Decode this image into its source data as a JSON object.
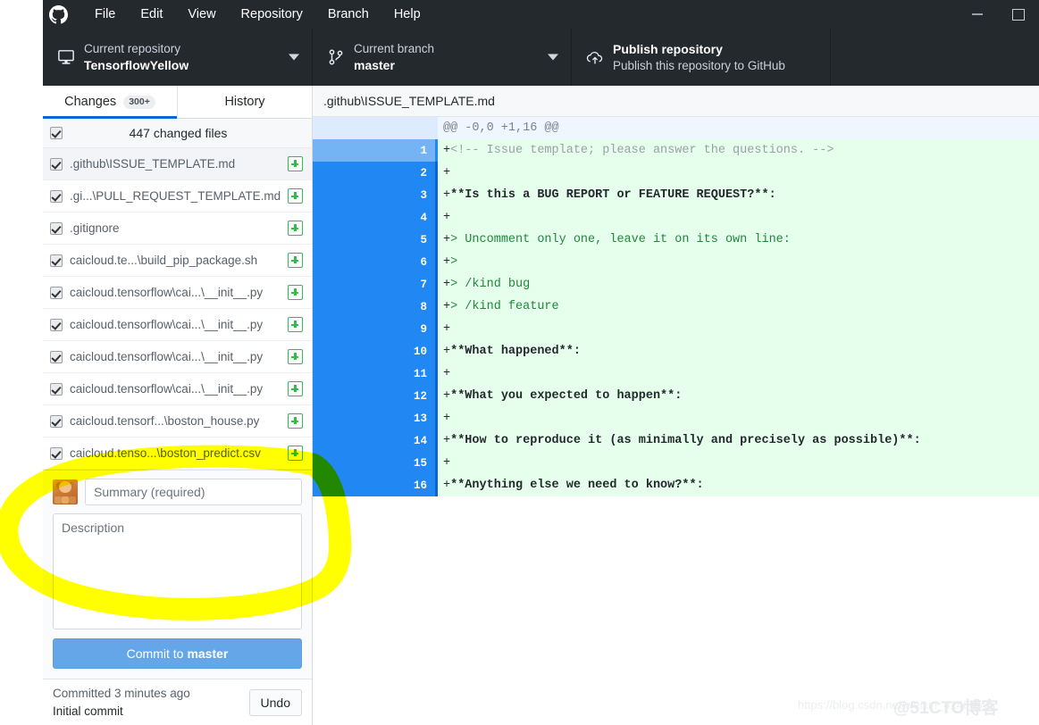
{
  "window": {
    "logo_icon": "github-logo-icon",
    "menu": [
      "File",
      "Edit",
      "View",
      "Repository",
      "Branch",
      "Help"
    ],
    "controls": {
      "minimize": "minimize-icon",
      "maximize": "maximize-icon"
    }
  },
  "toolbar": {
    "repository": {
      "icon": "repository-icon",
      "label": "Current repository",
      "value": "TensorflowYellow",
      "caret": "chevron-down-icon"
    },
    "branch": {
      "icon": "branch-icon",
      "label": "Current branch",
      "value": "master",
      "caret": "chevron-down-icon"
    },
    "publish": {
      "icon": "cloud-upload-icon",
      "title": "Publish repository",
      "subtitle": "Publish this repository to GitHub"
    }
  },
  "sidebar": {
    "tabs": [
      {
        "label": "Changes",
        "count": "300+",
        "active": true
      },
      {
        "label": "History",
        "count": "",
        "active": false
      }
    ],
    "select_all_label": "447 changed files",
    "files": [
      {
        "name": ".github\\ISSUE_TEMPLATE.md",
        "status": "added",
        "selected": true
      },
      {
        "name": ".gi...\\PULL_REQUEST_TEMPLATE.md",
        "status": "added",
        "selected": false
      },
      {
        "name": ".gitignore",
        "status": "added",
        "selected": false
      },
      {
        "name": "caicloud.te...\\build_pip_package.sh",
        "status": "added",
        "selected": false
      },
      {
        "name": "caicloud.tensorflow\\cai...\\__init__.py",
        "status": "added",
        "selected": false
      },
      {
        "name": "caicloud.tensorflow\\cai...\\__init__.py",
        "status": "added",
        "selected": false
      },
      {
        "name": "caicloud.tensorflow\\cai...\\__init__.py",
        "status": "added",
        "selected": false
      },
      {
        "name": "caicloud.tensorflow\\cai...\\__init__.py",
        "status": "added",
        "selected": false
      },
      {
        "name": "caicloud.tensorf...\\boston_house.py",
        "status": "added",
        "selected": false
      },
      {
        "name": "caicloud.tenso...\\boston_predict.csv",
        "status": "added",
        "selected": false
      }
    ],
    "commit": {
      "avatar": "user-avatar",
      "summary_placeholder": "Summary (required)",
      "description_placeholder": "Description",
      "button_prefix": "Commit to",
      "button_branch": "master"
    },
    "status": {
      "line1": "Committed 3 minutes ago",
      "line2": "Initial commit",
      "undo_label": "Undo"
    }
  },
  "diff": {
    "file_path": ".github\\ISSUE_TEMPLATE.md",
    "hunk_header": "@@ -0,0 +1,16 @@",
    "lines": [
      {
        "num": "1",
        "marker": "+",
        "text": "<!-- Issue template; please answer the questions. -->",
        "style": "comment"
      },
      {
        "num": "2",
        "marker": "+",
        "text": "",
        "style": "plain"
      },
      {
        "num": "3",
        "marker": "+",
        "text": "**Is this a BUG REPORT or FEATURE REQUEST?**:",
        "style": "bold"
      },
      {
        "num": "4",
        "marker": "+",
        "text": "",
        "style": "plain"
      },
      {
        "num": "5",
        "marker": "+",
        "text": "> Uncomment only one, leave it on its own line:",
        "style": "quote"
      },
      {
        "num": "6",
        "marker": "+",
        "text": ">",
        "style": "quote"
      },
      {
        "num": "7",
        "marker": "+",
        "text": "> /kind bug",
        "style": "quote"
      },
      {
        "num": "8",
        "marker": "+",
        "text": "> /kind feature",
        "style": "quote"
      },
      {
        "num": "9",
        "marker": "+",
        "text": "",
        "style": "plain"
      },
      {
        "num": "10",
        "marker": "+",
        "text": "**What happened**:",
        "style": "bold"
      },
      {
        "num": "11",
        "marker": "+",
        "text": "",
        "style": "plain"
      },
      {
        "num": "12",
        "marker": "+",
        "text": "**What you expected to happen**:",
        "style": "bold"
      },
      {
        "num": "13",
        "marker": "+",
        "text": "",
        "style": "plain"
      },
      {
        "num": "14",
        "marker": "+",
        "text": "**How to reproduce it (as minimally and precisely as possible)**:",
        "style": "bold"
      },
      {
        "num": "15",
        "marker": "+",
        "text": "",
        "style": "plain"
      },
      {
        "num": "16",
        "marker": "+",
        "text": "**Anything else we need to know?**:",
        "style": "bold"
      }
    ]
  },
  "annotation": {
    "shape": "hand-drawn-ellipse",
    "color": "#ffff00"
  },
  "watermarks": {
    "url": "https://blog.csdn.net/weixin_41466575",
    "site": "@51CTO博客"
  },
  "colors": {
    "titlebar_bg": "#24292e",
    "accent_blue": "#2188f3",
    "added_bg": "#e6ffed",
    "hunk_bg": "#eff6ff",
    "added_green": "#2cbe4e",
    "commit_button": "#64a6e8",
    "highlight_yellow": "#ffff00"
  }
}
